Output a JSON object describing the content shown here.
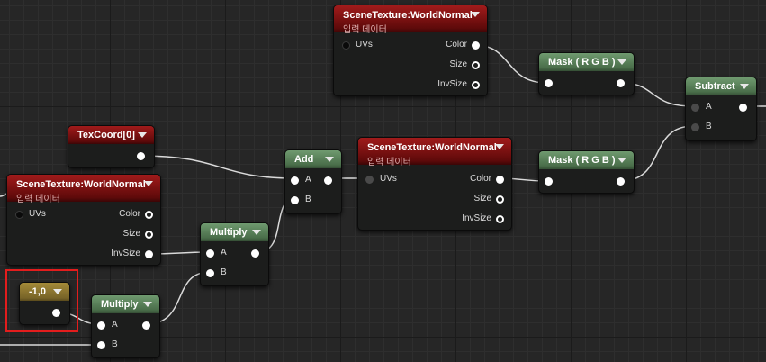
{
  "nodes": {
    "scene_top": {
      "title": "SceneTexture:WorldNormal",
      "subtitle": "입력 데이터",
      "input": "UVs",
      "outputs": [
        "Color",
        "Size",
        "InvSize"
      ]
    },
    "scene_mid": {
      "title": "SceneTexture:WorldNormal",
      "subtitle": "입력 데이터",
      "input": "UVs",
      "outputs": [
        "Color",
        "Size",
        "InvSize"
      ]
    },
    "scene_left": {
      "title": "SceneTexture:WorldNormal",
      "subtitle": "입력 데이터",
      "input": "UVs",
      "outputs": [
        "Color",
        "Size",
        "InvSize"
      ]
    },
    "texcoord": {
      "title": "TexCoord[0]"
    },
    "mask_top": {
      "title": "Mask ( R G B )"
    },
    "mask_mid": {
      "title": "Mask ( R G B )"
    },
    "subtract": {
      "title": "Subtract",
      "inputs": [
        "A",
        "B"
      ]
    },
    "add": {
      "title": "Add",
      "inputs": [
        "A",
        "B"
      ]
    },
    "multiply_1": {
      "title": "Multiply",
      "inputs": [
        "A",
        "B"
      ]
    },
    "multiply_2": {
      "title": "Multiply",
      "inputs": [
        "A",
        "B"
      ]
    },
    "constant": {
      "title": "-1,0"
    }
  },
  "colors": {
    "scene_texture_header": "#a11b1b",
    "math_header": "#6f9a6f",
    "constant_header": "#a48a38",
    "selection_outline": "#e31d1d"
  }
}
